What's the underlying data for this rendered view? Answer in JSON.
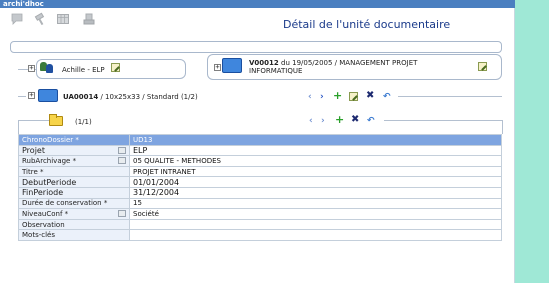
{
  "app": {
    "title": "archi'dhoc"
  },
  "header": {
    "title": "Détail de l'unité documentaire"
  },
  "toolbar": {
    "icons": [
      "speech-bubble-icon",
      "gavel-icon",
      "table-icon",
      "stamp-icon"
    ]
  },
  "context": {
    "person": {
      "label": "Achille - ELP"
    },
    "versement": {
      "id": "V00012",
      "line1_rest": " du 19/05/2005 / MANAGEMENT PROJET",
      "line2": "INFORMATIQUE"
    },
    "unit": {
      "id": "UA00014",
      "rest": " / 10x25x33 / Standard (1/2)"
    },
    "dossier": {
      "label": "(1/1)"
    }
  },
  "fields": [
    {
      "label": "ChronoDossier *",
      "value": "UD13",
      "lookup": false,
      "font": "small"
    },
    {
      "label": "Projet",
      "value": "ELP",
      "lookup": true,
      "font": "normal"
    },
    {
      "label": "RubArchivage *",
      "value": "05 QUALITE - METHODES",
      "lookup": true,
      "font": "small"
    },
    {
      "label": "Titre *",
      "value": "PROJET INTRANET",
      "lookup": false,
      "font": "small"
    },
    {
      "label": "DebutPeriode",
      "value": "01/01/2004",
      "lookup": false,
      "font": "normal"
    },
    {
      "label": "FinPeriode",
      "value": "31/12/2004",
      "lookup": false,
      "font": "normal"
    },
    {
      "label": "Durée de conservation *",
      "value": "15",
      "lookup": false,
      "font": "small"
    },
    {
      "label": "NiveauConf *",
      "value": "Société",
      "lookup": true,
      "font": "small"
    },
    {
      "label": "Observation",
      "value": "",
      "lookup": false,
      "font": "small"
    },
    {
      "label": "Mots-clés",
      "value": "",
      "lookup": false,
      "font": "small"
    }
  ],
  "colors": {
    "accent": "#4a7fc0",
    "title": "#1a3a8a",
    "selected_row": "#7ea4e0",
    "background": "#9fe8d6"
  }
}
